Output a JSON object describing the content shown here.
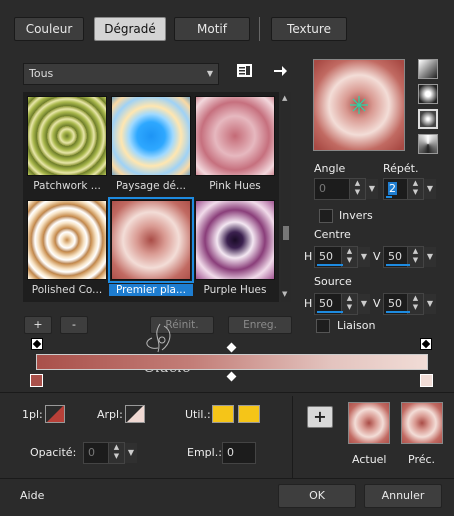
{
  "tabs": [
    {
      "label": "Couleur"
    },
    {
      "label": "Dégradé"
    },
    {
      "label": "Motif"
    },
    {
      "label": "Texture"
    }
  ],
  "category": {
    "selected": "Tous"
  },
  "presets": [
    {
      "label": "Patchwork ..."
    },
    {
      "label": "Paysage dé..."
    },
    {
      "label": "Pink Hues"
    },
    {
      "label": "Polished Co..."
    },
    {
      "label": "Premier pla..."
    },
    {
      "label": "Purple Hues"
    }
  ],
  "angle": {
    "label": "Angle",
    "value": "0"
  },
  "repeat": {
    "label": "Répét.",
    "value": "2"
  },
  "invert": {
    "label": "Invers",
    "checked": false
  },
  "centre": {
    "label": "Centre",
    "h_label": "H",
    "h_value": "50",
    "v_label": "V",
    "v_value": "50"
  },
  "source": {
    "label": "Source",
    "h_label": "H",
    "h_value": "50",
    "v_label": "V",
    "v_value": "50"
  },
  "link": {
    "label": "Liaison",
    "checked": false
  },
  "gradient_buttons": {
    "add": "+",
    "remove": "-",
    "reset": "Réinit.",
    "save": "Enreg."
  },
  "watermark": "Claclo",
  "stops": {
    "first_label": "1pl:",
    "bg_label": "Arpl:",
    "user_label": "Util.:",
    "opacity_label": "Opacité:",
    "opacity_value": "0",
    "location_label": "Empl.:",
    "location_value": "0"
  },
  "preview": {
    "add": "+",
    "current": "Actuel",
    "previous": "Préc."
  },
  "footer": {
    "help": "Aide",
    "ok": "OK",
    "cancel": "Annuler"
  },
  "colors": {
    "accent": "#1e8be0",
    "gradient_dark": "#b0524c",
    "gradient_light": "#f1dcd6",
    "user_swatch": "#f5c518"
  }
}
